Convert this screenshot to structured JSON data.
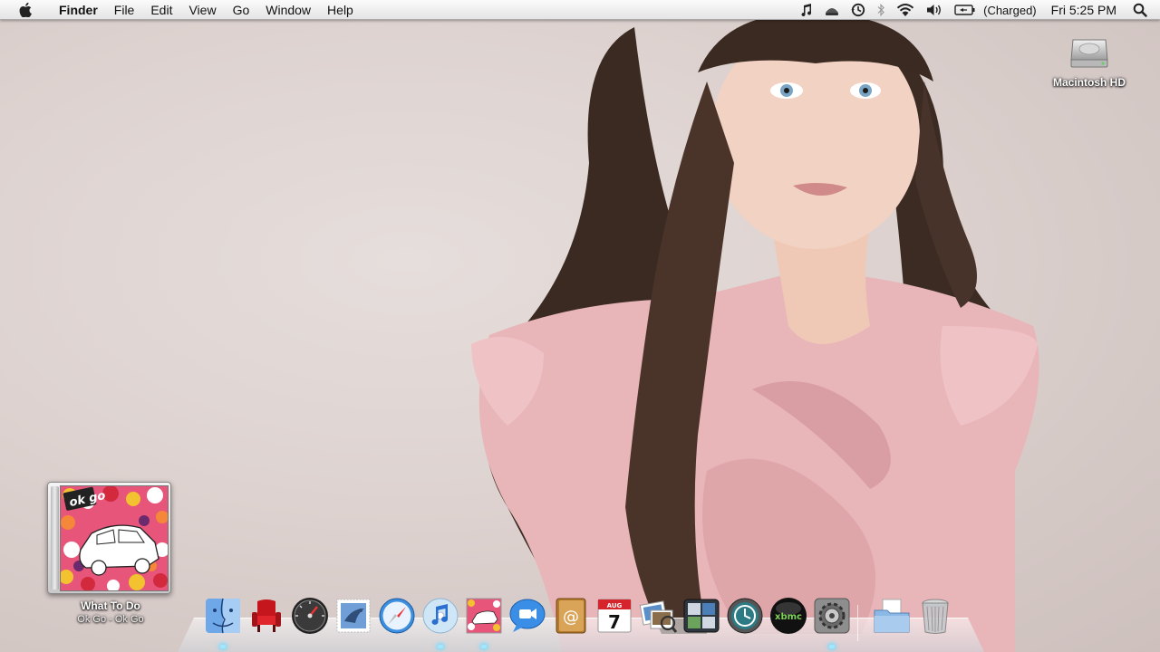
{
  "menubar": {
    "app_name": "Finder",
    "menus": [
      "File",
      "Edit",
      "View",
      "Go",
      "Window",
      "Help"
    ],
    "status": {
      "battery_status": "(Charged)",
      "clock": "Fri 5:25 PM"
    }
  },
  "desktop": {
    "hd_label": "Macintosh HD"
  },
  "now_playing": {
    "title": "What To Do",
    "artist_album": "Ok Go - Ok Go",
    "album_art_text": "ok go"
  },
  "dock": {
    "items": [
      {
        "name": "Finder",
        "running": true
      },
      {
        "name": "Front Row",
        "running": false
      },
      {
        "name": "Dashboard",
        "running": false
      },
      {
        "name": "Mail",
        "running": false
      },
      {
        "name": "Safari",
        "running": false
      },
      {
        "name": "iTunes",
        "running": true
      },
      {
        "name": "Album Art",
        "running": true
      },
      {
        "name": "iChat",
        "running": false
      },
      {
        "name": "Address Book",
        "running": false
      },
      {
        "name": "iCal",
        "running": false
      },
      {
        "name": "Preview",
        "running": false
      },
      {
        "name": "Spaces",
        "running": false
      },
      {
        "name": "Time Machine",
        "running": false
      },
      {
        "name": "XBMC",
        "running": false
      },
      {
        "name": "System Preferences",
        "running": true
      },
      {
        "name": "Documents",
        "running": false
      },
      {
        "name": "Trash",
        "running": false
      }
    ],
    "ical_month": "AUG",
    "ical_day": "7",
    "xbmc_text": "xbmc"
  },
  "colors": {
    "wallpaper": "#dcd1cf",
    "menubar_top": "#fbfbfb",
    "menubar_bottom": "#e4e4e4",
    "running_light": "#9fe8ff"
  }
}
